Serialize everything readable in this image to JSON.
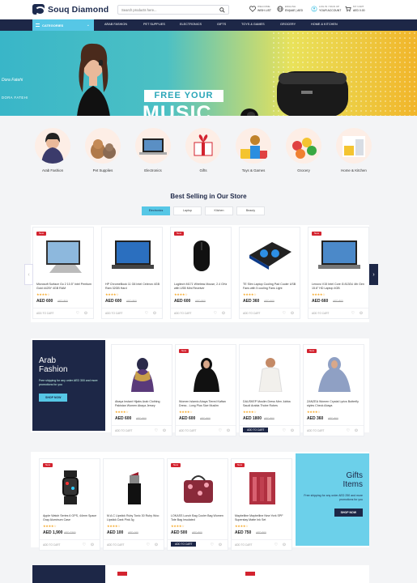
{
  "brand": {
    "name": "Souq Diamond"
  },
  "search": {
    "placeholder": "Search products here..."
  },
  "header": {
    "wishlist": {
      "l1": "WELCOME",
      "l2": "WISH LIST"
    },
    "language": {
      "l1": "ENGLISH",
      "l2": "EN|UAE | AED"
    },
    "account": {
      "l1": "LOG IN / SIGN UP",
      "l2": "YOUR ACCOUNT"
    },
    "cart": {
      "l1": "MY CART",
      "l2": "AED 0.00"
    }
  },
  "nav": {
    "categories_label": "CATEGORIES",
    "links": [
      "ARAB FASHION",
      "PET SUPPLIES",
      "ELECTRONICS",
      "GIFTS",
      "TOYS & GAMES",
      "GROCERY",
      "HOME & KITCHEN"
    ]
  },
  "hero": {
    "signature": "Dora Fatehi",
    "signature_caps": "DORA FATEHI",
    "line1": "FREE YOUR",
    "line2": "MUSIC"
  },
  "categories": [
    {
      "label": "Arab Fashion"
    },
    {
      "label": "Pet Supplies"
    },
    {
      "label": "Electronics"
    },
    {
      "label": "Gifts"
    },
    {
      "label": "Toys & Games"
    },
    {
      "label": "Grocery"
    },
    {
      "label": "Home & Kitchen"
    }
  ],
  "best_selling": {
    "title": "Best Selling in Our Store",
    "tabs": [
      "Electronics",
      "Laptop",
      "Kitchen",
      "Beauty"
    ],
    "products": [
      {
        "name": "Microsoft Surface Go 2 10.5\" Intel Pentium Gold 4425Y 4GB RAM",
        "price": "AED 600",
        "old": "AED 800",
        "badge": "New"
      },
      {
        "name": "HP ChromeBook 11 G8 Intel Celeron 4GB Ram 32GB Hard",
        "price": "AED 600",
        "old": "AED 800",
        "badge": ""
      },
      {
        "name": "Logitech M171 Wireless Mouse, 2.4 GHz with USB Mini Receiver",
        "price": "AED 600",
        "old": "AED 800",
        "badge": "New"
      },
      {
        "name": "TE Slim Laptop Cooling Pad Cooler USB Fans with 5 cooling Fans Light",
        "price": "AED 360",
        "old": "AED 600",
        "badge": ""
      },
      {
        "name": "Lenovo V15 Intel Core i3 8130U 4th Gen 15.6\" HD Laptop 4GB",
        "price": "AED 660",
        "old": "AED 800",
        "badge": "New"
      }
    ]
  },
  "fashion": {
    "promo": {
      "t1": "Arab",
      "t2": "Fashion",
      "text": "Free shipping for any order AED 300 and more promotions for you",
      "button": "SHOP NOW"
    },
    "products": [
      {
        "name": "Abaya Instant Hijabs Arab Clothing Pakistan Women Abaya Jersey",
        "price": "AED 600",
        "old": "AED 800",
        "badge": ""
      },
      {
        "name": "Women Islamic Abaya Tiered Kaftan Dress - Long Plus Size Muslim",
        "price": "AED 600",
        "old": "AED 800",
        "badge": "New"
      },
      {
        "name": "DAUSKEP Muslim Dress Men Jubba Saudi Arabia Thobe Robes",
        "price": "AED 1800",
        "old": "AED 800",
        "badge": ""
      },
      {
        "name": "ZANZEA Women Crystal Lyrics Butterfly styles Check Abaya",
        "price": "AED 360",
        "old": "AED 800",
        "badge": "New"
      }
    ],
    "add_to_cart": "ADD TO CART"
  },
  "gifts": {
    "promo": {
      "t1": "Gifts",
      "t2": "Items",
      "text": "Free shipping for any order AED 250 and more promotions for you",
      "button": "SHOP NOW"
    },
    "products": [
      {
        "name": "Apple Watch Series 6 GPS, 44mm Space Gray Aluminum Case",
        "price": "AED 1,900",
        "old": "AED 2300",
        "badge": "New"
      },
      {
        "name": "M.A.C Lipstick Ruby Tonic 30 Ruby Woo Lipstick Dark Pink 3g",
        "price": "AED 100",
        "old": "AED 160",
        "badge": ""
      },
      {
        "name": "LOKASS Lunch Bag Cooler Bag Women Tote Bag Insulated",
        "price": "AED 500",
        "old": "AED 800",
        "badge": "New"
      },
      {
        "name": "Maybelline Maybelline New York SPF Superstay Matte Ink Set",
        "price": "AED 750",
        "old": "AED 900",
        "badge": "New"
      }
    ]
  },
  "common": {
    "add_to_cart": "ADD TO CART",
    "stars": "★★★★☆"
  }
}
